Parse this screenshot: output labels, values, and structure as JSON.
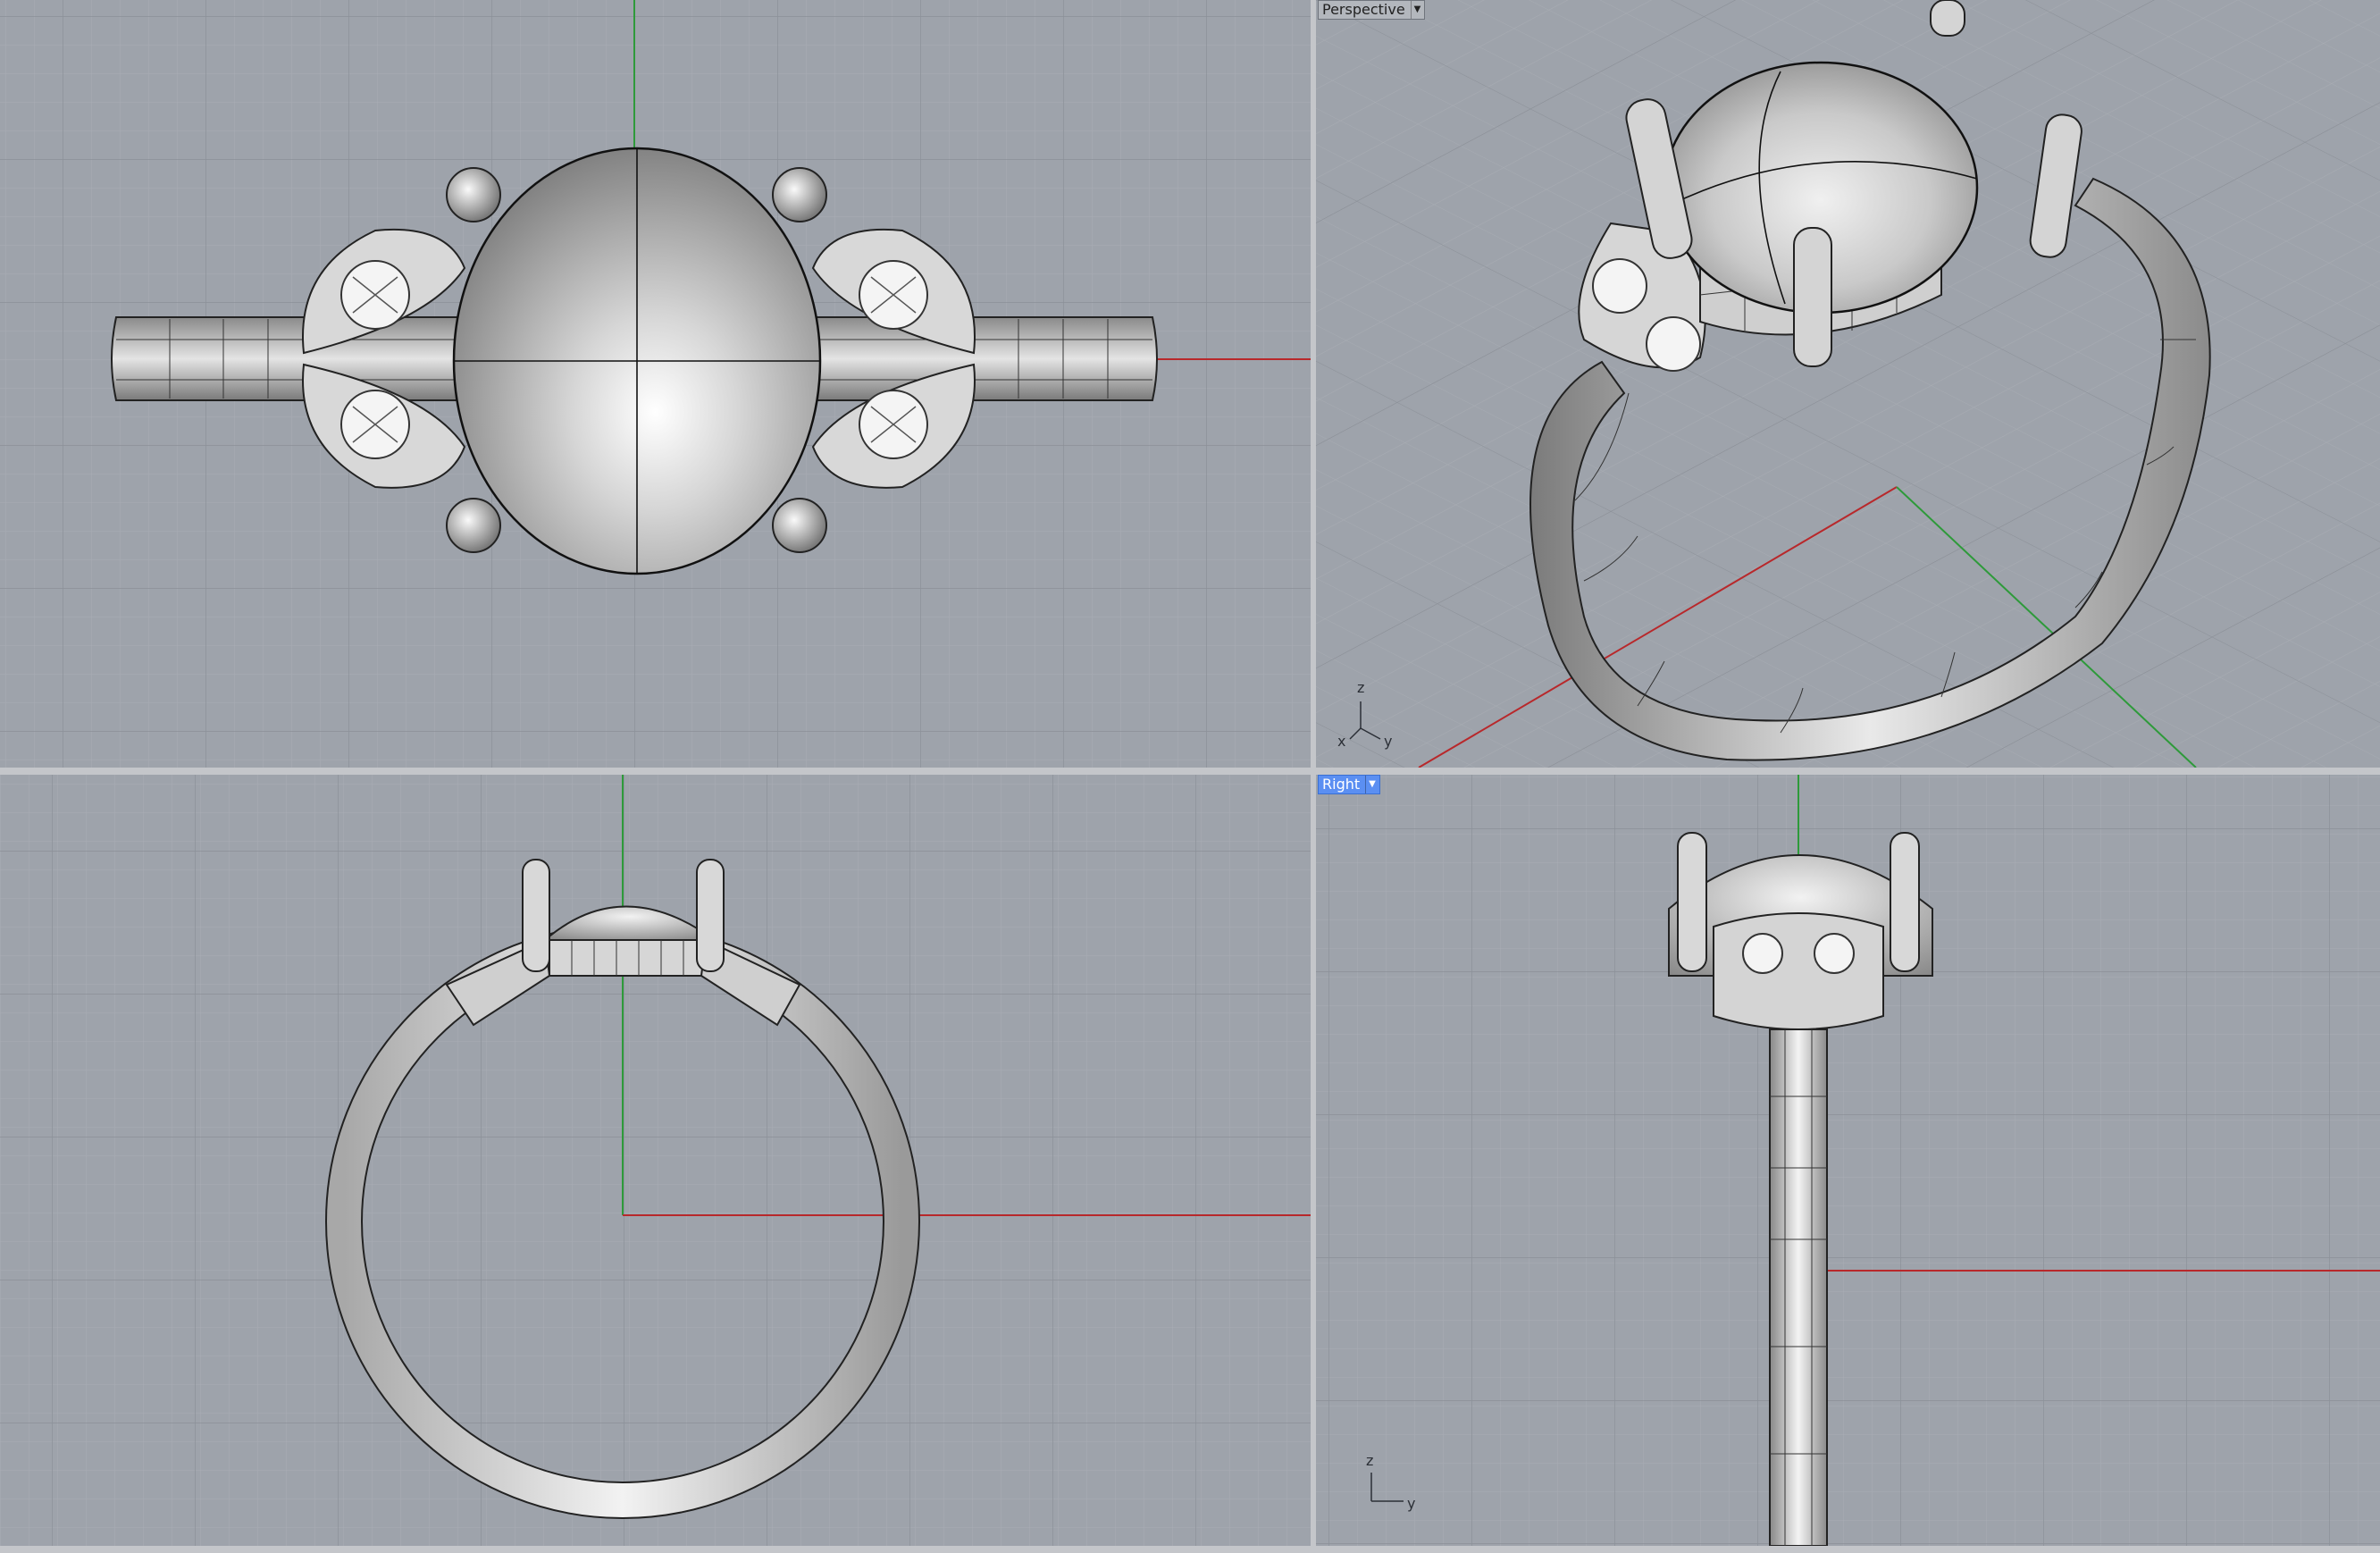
{
  "viewports": {
    "top": {
      "label": ""
    },
    "perspective": {
      "label": "Perspective"
    },
    "front": {
      "label": ""
    },
    "right": {
      "label": "Right"
    }
  },
  "axes": {
    "perspective": {
      "z": "z",
      "x": "x",
      "y": "y"
    },
    "right": {
      "z": "z",
      "y": "y"
    }
  },
  "colors": {
    "viewport_bg": "#9ea3ab",
    "grid_minor": "#a9adb4",
    "grid_major": "#8e939b",
    "x_axis": "#b8282b",
    "y_axis": "#2e9a3a",
    "active_label": "#5b8ff2",
    "model": "#bdbdbd"
  }
}
